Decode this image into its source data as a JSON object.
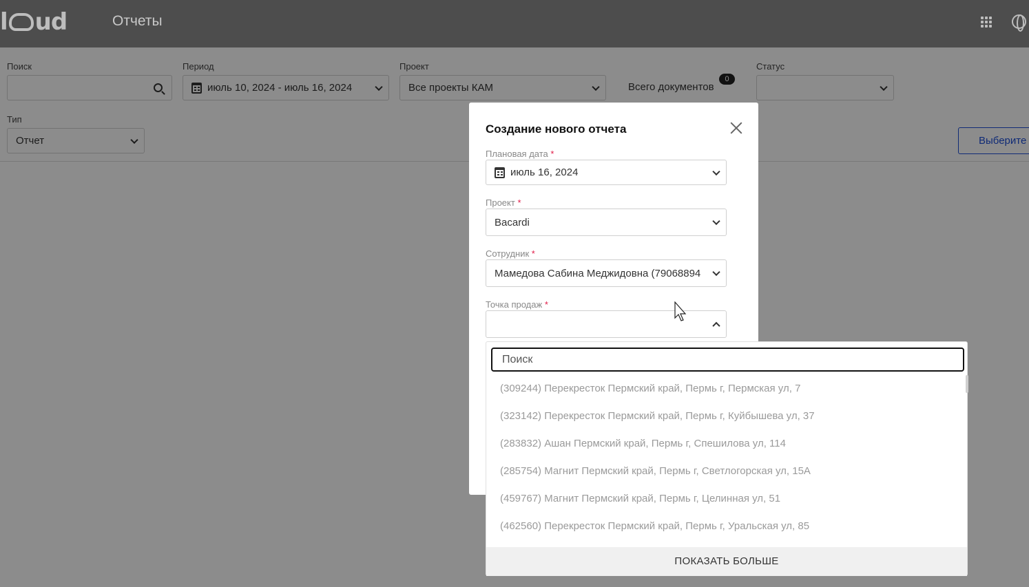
{
  "header": {
    "logo": "cloud",
    "page_title": "Отчеты",
    "apps_icon": "grid-icon",
    "language_icon": "globe-icon"
  },
  "filters": {
    "search": {
      "label": "Поиск",
      "value": ""
    },
    "period": {
      "label": "Период",
      "value": "июль 10, 2024 - июль 16, 2024"
    },
    "project": {
      "label": "Проект",
      "value": "Все проекты КАМ"
    },
    "documents": {
      "label": "Всего документов",
      "count": "0"
    },
    "status": {
      "label": "Статус",
      "value": ""
    },
    "type": {
      "label": "Тип",
      "value": "Отчет"
    },
    "select_button": "Выберите"
  },
  "modal": {
    "title": "Создание нового отчета",
    "required_mark": "*",
    "planned_date": {
      "label": "Плановая дата",
      "value": "июль 16, 2024"
    },
    "project": {
      "label": "Проект",
      "value": "Bacardi"
    },
    "employee": {
      "label": "Сотрудник",
      "value": "Мамедова Сабина Меджидовна (79068894"
    },
    "point_of_sale": {
      "label": "Точка продаж",
      "value": ""
    }
  },
  "dropdown": {
    "search_placeholder": "Поиск",
    "items": [
      "(309244) Перекресток Пермский край, Пермь г, Пермская ул, 7",
      "(323142) Перекресток Пермский край, Пермь г, Куйбышева ул, 37",
      "(283832) Ашан Пермский край, Пермь г, Спешилова ул, 114",
      "(285754) Магнит Пермский край, Пермь г, Светлогорская ул, 15А",
      "(459767) Магнит Пермский край, Пермь г, Целинная ул, 51",
      "(462560) Перекресток Пермский край, Пермь г, Уральская ул, 85"
    ],
    "show_more": "ПОКАЗАТЬ БОЛЬШЕ"
  },
  "colors": {
    "topbar": "#1b1b1b",
    "accent": "#1d4ed8",
    "required": "#e11d48"
  }
}
